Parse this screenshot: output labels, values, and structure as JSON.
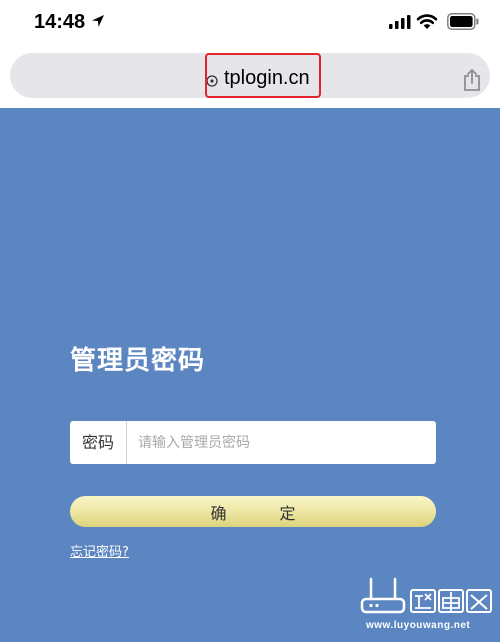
{
  "status_bar": {
    "time": "14:48",
    "icons": [
      "location-arrow-icon",
      "signal-icon",
      "wifi-icon",
      "battery-icon"
    ]
  },
  "browser": {
    "url": "tplogin.cn",
    "icons": [
      "info-icon",
      "share-icon"
    ],
    "highlight_color": "#e3242b"
  },
  "login": {
    "title": "管理员密码",
    "password_label": "密码",
    "password_placeholder": "请输入管理员密码",
    "password_value": "",
    "confirm_label": "确 定",
    "forgot_link": "忘记密码?"
  },
  "watermark": {
    "url": "www.luyouwang.net"
  },
  "colors": {
    "background": "#5c86c2",
    "button": "#ece5a0",
    "text_white": "#ffffff"
  }
}
